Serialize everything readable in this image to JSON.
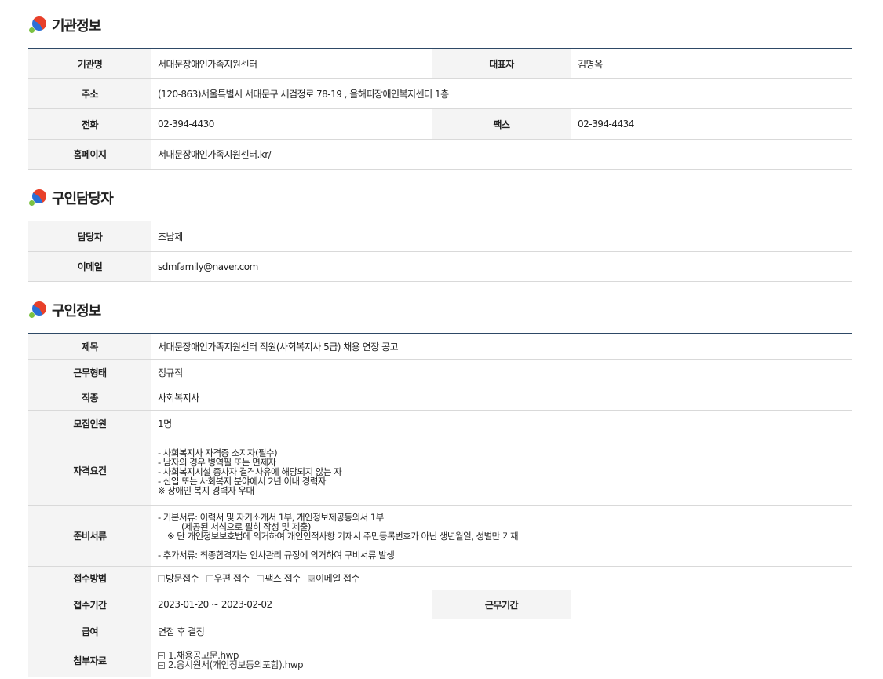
{
  "sections": {
    "org": {
      "title": "기관정보"
    },
    "contact": {
      "title": "구인담당자"
    },
    "job": {
      "title": "구인정보"
    }
  },
  "org": {
    "name_label": "기관명",
    "name": "서대문장애인가족지원센터",
    "rep_label": "대표자",
    "rep": "김명옥",
    "addr_label": "주소",
    "addr": "(120-863)서울특별시 서대문구 세검정로 78-19 , 올해피장애인복지센터 1층",
    "tel_label": "전화",
    "tel": "02-394-4430",
    "fax_label": "팩스",
    "fax": "02-394-4434",
    "home_label": "홈페이지",
    "home": "서대문장애인가족지원센터.kr/"
  },
  "contact": {
    "person_label": "담당자",
    "person": "조남제",
    "email_label": "이메일",
    "email": "sdmfamily@naver.com"
  },
  "job": {
    "title_label": "제목",
    "title": "서대문장애인가족지원센터 직원(사회복지사 5급) 채용 연장 공고",
    "type_label": "근무형태",
    "type": "정규직",
    "kind_label": "직종",
    "kind": "사회복지사",
    "count_label": "모집인원",
    "count": "1명",
    "req_label": "자격요건",
    "req_lines": [
      "- 사회복지사 자격증 소지자(필수)",
      "- 남자의 경우 병역필 또는 면제자",
      "- 사회복지시설 종사자 결격사유에 해당되지 않는 자",
      "- 신입 또는 사회복지 분야에서 2년 이내 경력자",
      "※ 장애인 복지 경력자 우대"
    ],
    "docs_label": "준비서류",
    "docs_lines": [
      "- 기본서류: 이력서 및 자기소개서 1부, 개인정보제공동의서 1부",
      "(제공된 서식으로 필히 작성 및 제출)",
      "※ 단 개인정보보호법에 의거하여 개인인적사항 기재시 주민등록번호가 아닌 생년월일, 성별만 기재",
      "- 추가서류: 최종합격자는 인사관리 규정에 의거하여 구비서류 발생"
    ],
    "method_label": "접수방법",
    "methods": [
      "방문접수",
      "우편 접수",
      "팩스 접수",
      "이메일 접수"
    ],
    "period_label": "접수기간",
    "period": "2023-01-20 ~ 2023-02-02",
    "workperiod_label": "근무기간",
    "workperiod": "",
    "pay_label": "급여",
    "pay": "면접 후 결정",
    "attach_label": "첨부자료",
    "attachments": [
      "1.채용공고문.hwp",
      "2.응시원서(개인정보동의포함).hwp"
    ]
  }
}
